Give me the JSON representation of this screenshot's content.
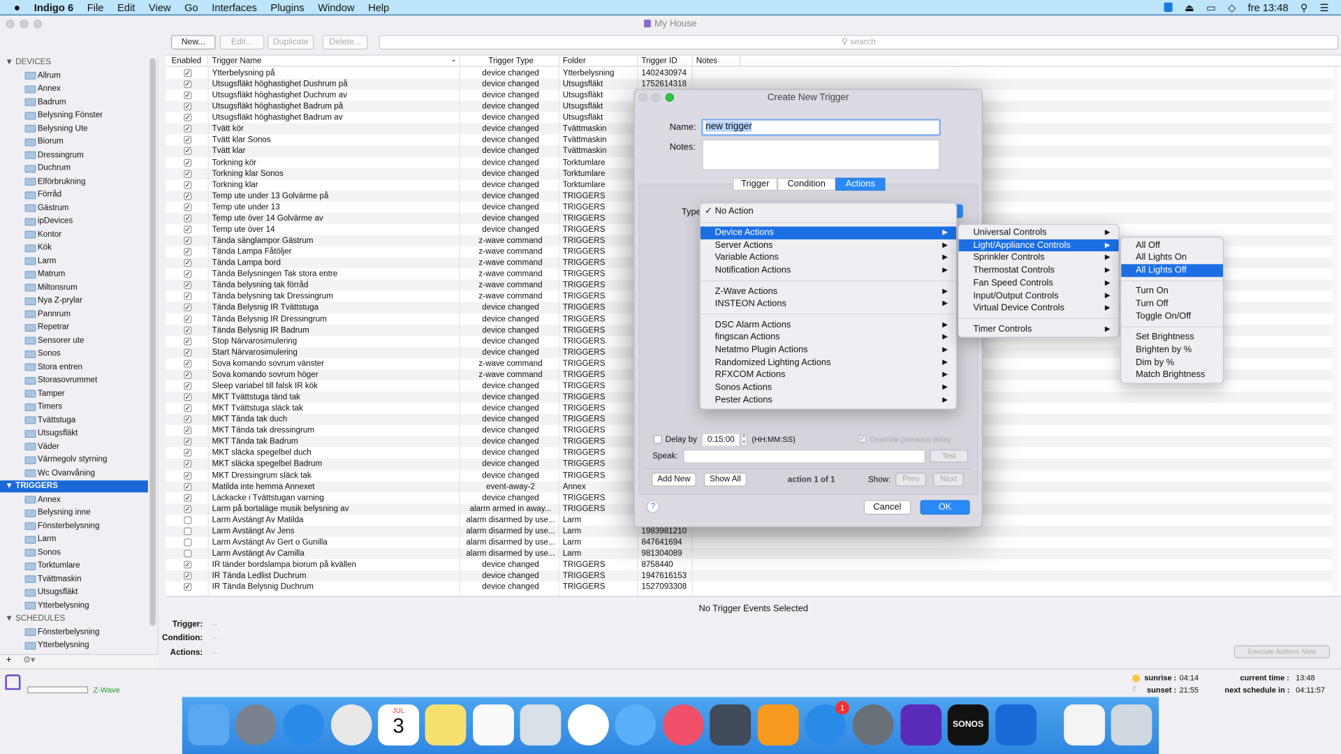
{
  "menubar": {
    "app": "Indigo 6",
    "items": [
      "File",
      "Edit",
      "View",
      "Go",
      "Interfaces",
      "Plugins",
      "Window",
      "Help"
    ],
    "clock": "fre 13:48",
    "icons": [
      "teamviewer-icon",
      "eject-icon",
      "airplay-icon",
      "wifi-icon",
      "spotlight-icon",
      "notification-center-icon"
    ]
  },
  "window": {
    "title": "My House"
  },
  "toolbar": {
    "new": "New...",
    "edit": "Edit...",
    "duplicate": "Duplicate",
    "delete": "Delete...",
    "search_placeholder": "search"
  },
  "sidebar": {
    "devices_label": "DEVICES",
    "devices": [
      "Allrum",
      "Annex",
      "Badrum",
      "Belysning Fönster",
      "Belysning Ute",
      "Biorum",
      "Dressingrum",
      "Duchrum",
      "Elförbrukning",
      "Förråd",
      "Gästrum",
      "ipDevices",
      "Kontor",
      "Kök",
      "Larm",
      "Matrum",
      "Miltonsrum",
      "Nya Z-prylar",
      "Pannrum",
      "Repetrar",
      "Sensorer ute",
      "Sonos",
      "Stora entren",
      "Storasovrummet",
      "Tamper",
      "Timers",
      "Tvättstuga",
      "Utsugsfläkt",
      "Väder",
      "Värmegolv styrning",
      "Wc Ovanvåning"
    ],
    "triggers_label": "TRIGGERS",
    "triggers": [
      "Annex",
      "Belysning inne",
      "Fönsterbelysning",
      "Larm",
      "Sonos",
      "Torktumlare",
      "Tvättmaskin",
      "Utsugsfläkt",
      "Ytterbelysning"
    ],
    "schedules_label": "SCHEDULES",
    "schedules": [
      "Fönsterbelysning",
      "Ytterbelysning"
    ],
    "add": "+",
    "gear": "⚙▾"
  },
  "table": {
    "columns": [
      "Enabled",
      "Trigger Name",
      "Trigger Type",
      "Folder",
      "Trigger ID",
      "Notes"
    ],
    "rows": [
      {
        "on": true,
        "name": "Ytterbelysning på",
        "type": "device changed",
        "folder": "Ytterbelysning",
        "id": "1402430974"
      },
      {
        "on": true,
        "name": "Utsugsfläkt höghastighet Dushrum på",
        "type": "device changed",
        "folder": "Utsugsfläkt",
        "id": "1752614318"
      },
      {
        "on": true,
        "name": "Utsugsfläkt höghastighet Duchrum av",
        "type": "device changed",
        "folder": "Utsugsfläkt",
        "id": ""
      },
      {
        "on": true,
        "name": "Utsugsfläkt höghastighet Badrum på",
        "type": "device changed",
        "folder": "Utsugsfläkt",
        "id": ""
      },
      {
        "on": true,
        "name": "Utsugsfläkt höghastighet Badrum av",
        "type": "device changed",
        "folder": "Utsugsfläkt",
        "id": ""
      },
      {
        "on": true,
        "name": "Tvätt kör",
        "type": "device changed",
        "folder": "Tvättmaskin",
        "id": ""
      },
      {
        "on": true,
        "name": "Tvätt klar Sonos",
        "type": "device changed",
        "folder": "Tvättmaskin",
        "id": ""
      },
      {
        "on": true,
        "name": "Tvätt klar",
        "type": "device changed",
        "folder": "Tvättmaskin",
        "id": ""
      },
      {
        "on": true,
        "name": "Torkning kör",
        "type": "device changed",
        "folder": "Torktumlare",
        "id": ""
      },
      {
        "on": true,
        "name": "Torkning klar Sonos",
        "type": "device changed",
        "folder": "Torktumlare",
        "id": ""
      },
      {
        "on": true,
        "name": "Torkning klar",
        "type": "device changed",
        "folder": "Torktumlare",
        "id": ""
      },
      {
        "on": true,
        "name": "Temp ute under 13 Golvärme på",
        "type": "device changed",
        "folder": "TRIGGERS",
        "id": ""
      },
      {
        "on": true,
        "name": "Temp ute under 13",
        "type": "device changed",
        "folder": "TRIGGERS",
        "id": ""
      },
      {
        "on": true,
        "name": "Temp ute över 14 Golvärme av",
        "type": "device changed",
        "folder": "TRIGGERS",
        "id": ""
      },
      {
        "on": true,
        "name": "Temp ute över 14",
        "type": "device changed",
        "folder": "TRIGGERS",
        "id": ""
      },
      {
        "on": true,
        "name": "Tända sänglampor Gästrum",
        "type": "z-wave command",
        "folder": "TRIGGERS",
        "id": ""
      },
      {
        "on": true,
        "name": "Tända Lampa Fåtöljer",
        "type": "z-wave command",
        "folder": "TRIGGERS",
        "id": ""
      },
      {
        "on": true,
        "name": "Tända Lampa bord",
        "type": "z-wave command",
        "folder": "TRIGGERS",
        "id": ""
      },
      {
        "on": true,
        "name": "Tända Belysningen Tak stora entre",
        "type": "z-wave command",
        "folder": "TRIGGERS",
        "id": ""
      },
      {
        "on": true,
        "name": "Tända belysning tak förråd",
        "type": "z-wave command",
        "folder": "TRIGGERS",
        "id": ""
      },
      {
        "on": true,
        "name": "Tända belysning tak Dressingrum",
        "type": "z-wave command",
        "folder": "TRIGGERS",
        "id": ""
      },
      {
        "on": true,
        "name": "Tända Belysnig IR Tvättstuga",
        "type": "device changed",
        "folder": "TRIGGERS",
        "id": ""
      },
      {
        "on": true,
        "name": "Tända Belysnig IR Dressingrum",
        "type": "device changed",
        "folder": "TRIGGERS",
        "id": ""
      },
      {
        "on": true,
        "name": "Tända Belysnig IR Badrum",
        "type": "device changed",
        "folder": "TRIGGERS",
        "id": ""
      },
      {
        "on": true,
        "name": "Stop Närvarosimulering",
        "type": "device changed",
        "folder": "TRIGGERS",
        "id": ""
      },
      {
        "on": true,
        "name": "Start Närvarosimulering",
        "type": "device changed",
        "folder": "TRIGGERS",
        "id": ""
      },
      {
        "on": true,
        "name": "Sova komando sovrum vänster",
        "type": "z-wave command",
        "folder": "TRIGGERS",
        "id": ""
      },
      {
        "on": true,
        "name": "Sova komando sovrum höger",
        "type": "z-wave command",
        "folder": "TRIGGERS",
        "id": ""
      },
      {
        "on": true,
        "name": "Sleep variabel till falsk IR kök",
        "type": "device changed",
        "folder": "TRIGGERS",
        "id": ""
      },
      {
        "on": true,
        "name": "MKT Tvättstuga tänd tak",
        "type": "device changed",
        "folder": "TRIGGERS",
        "id": ""
      },
      {
        "on": true,
        "name": "MKT Tvättstuga släck tak",
        "type": "device changed",
        "folder": "TRIGGERS",
        "id": ""
      },
      {
        "on": true,
        "name": "MKT Tända tak duch",
        "type": "device changed",
        "folder": "TRIGGERS",
        "id": ""
      },
      {
        "on": true,
        "name": "MKT Tända tak dressingrum",
        "type": "device changed",
        "folder": "TRIGGERS",
        "id": ""
      },
      {
        "on": true,
        "name": "MKT Tända tak Badrum",
        "type": "device changed",
        "folder": "TRIGGERS",
        "id": ""
      },
      {
        "on": true,
        "name": "MKT släcka spegelbel duch",
        "type": "device changed",
        "folder": "TRIGGERS",
        "id": ""
      },
      {
        "on": true,
        "name": "MKT släcka spegelbel Badrum",
        "type": "device changed",
        "folder": "TRIGGERS",
        "id": ""
      },
      {
        "on": true,
        "name": "MKT Dressingrum släck tak",
        "type": "device changed",
        "folder": "TRIGGERS",
        "id": ""
      },
      {
        "on": true,
        "name": "Matilda inte hemma Annexet",
        "type": "event-away-2",
        "folder": "Annex",
        "id": ""
      },
      {
        "on": true,
        "name": "Läckacke i Tvättstugan varning",
        "type": "device changed",
        "folder": "TRIGGERS",
        "id": ""
      },
      {
        "on": true,
        "name": "Larm på bortaläge musik belysning av",
        "type": "alarm armed in away...",
        "folder": "TRIGGERS",
        "id": ""
      },
      {
        "on": false,
        "name": "Larm Avstängt Av Matilda",
        "type": "alarm disarmed by use...",
        "folder": "Larm",
        "id": ""
      },
      {
        "on": false,
        "name": "Larm Avstängt Av Jens",
        "type": "alarm disarmed by use...",
        "folder": "Larm",
        "id": "1983981210"
      },
      {
        "on": false,
        "name": "Larm Avstängt Av Gert o Gunilla",
        "type": "alarm disarmed by use...",
        "folder": "Larm",
        "id": "847641694"
      },
      {
        "on": false,
        "name": "Larm Avstängt Av Camilla",
        "type": "alarm disarmed by use...",
        "folder": "Larm",
        "id": "981304089"
      },
      {
        "on": true,
        "name": "IR tänder bordslampa biorum på kvällen",
        "type": "device changed",
        "folder": "TRIGGERS",
        "id": "8758440"
      },
      {
        "on": true,
        "name": "IR Tända Ledlist Duchrum",
        "type": "device changed",
        "folder": "TRIGGERS",
        "id": "1947616153"
      },
      {
        "on": true,
        "name": "IR Tända Belysnig Duchrum",
        "type": "device changed",
        "folder": "TRIGGERS",
        "id": "1527093308"
      }
    ]
  },
  "detail": {
    "empty": "No Trigger Events Selected",
    "trigger_label": "Trigger:",
    "condition_label": "Condition:",
    "actions_label": "Actions:",
    "trigger": "--",
    "condition": "--",
    "actions": "--",
    "execute": "Execute Actions Now"
  },
  "status": {
    "interface": "Z-Wave",
    "sunrise_label": "sunrise :",
    "sunrise": "04:14",
    "sunset_label": "sunset :",
    "sunset": "21:55",
    "current_label": "current time :",
    "current": "13:48",
    "next_label": "next schedule in :",
    "next": "04:11:57"
  },
  "dialog": {
    "title": "Create New Trigger",
    "name_label": "Name:",
    "name_value": "new trigger",
    "notes_label": "Notes:",
    "notes_value": "",
    "tabs": [
      "Trigger",
      "Condition",
      "Actions"
    ],
    "active_tab": "Actions",
    "type_label": "Type",
    "delay_label": "Delay by",
    "delay_value": "0:15:00",
    "delay_unit": "(HH:MM:SS)",
    "override": "Override previous delay",
    "speak_label": "Speak:",
    "test": "Test",
    "add_new": "Add New",
    "show_all": "Show All",
    "counter": "action 1 of 1",
    "show_label": "Show:",
    "prev": "Prev",
    "next": "Next",
    "help": "?",
    "cancel": "Cancel",
    "ok": "OK"
  },
  "menus": {
    "main": {
      "checked": "No Action",
      "groups": [
        [
          "Device Actions",
          "Server Actions",
          "Variable Actions",
          "Notification Actions"
        ],
        [
          "Z-Wave Actions",
          "INSTEON Actions"
        ],
        [
          "DSC Alarm Actions",
          "fingscan Actions",
          "Netatmo Plugin Actions",
          "Randomized Lighting Actions",
          "RFXCOM Actions",
          "Sonos Actions",
          "Pester Actions"
        ]
      ],
      "highlighted": "Device Actions"
    },
    "device": {
      "groups": [
        [
          "Universal Controls",
          "Light/Appliance Controls",
          "Sprinkler Controls",
          "Thermostat Controls",
          "Fan Speed Controls",
          "Input/Output Controls",
          "Virtual Device Controls"
        ],
        [
          "Timer Controls"
        ]
      ],
      "highlighted": "Light/Appliance Controls"
    },
    "light": {
      "groups": [
        [
          "All Off",
          "All Lights On",
          "All Lights Off"
        ],
        [
          "Turn On",
          "Turn Off",
          "Toggle On/Off"
        ],
        [
          "Set Brightness",
          "Brighten by %",
          "Dim by %",
          "Match Brightness"
        ]
      ],
      "highlighted": "All Lights Off"
    }
  },
  "dock": {
    "apps": [
      "finder",
      "launchpad",
      "safari",
      "chrome",
      "calendar",
      "notes",
      "reminders",
      "preview",
      "photos",
      "messages",
      "itunes",
      "imovie",
      "ibooks",
      "app-store",
      "system-preferences",
      "indigo",
      "sonos",
      "teamviewer",
      "documents",
      "trash"
    ],
    "calendar_month": "JUL",
    "calendar_day": "3",
    "app_store_badge": "1",
    "sonos_label": "SONOS"
  },
  "colors": {
    "accent": "#1b6fe3",
    "menubar": "#bde6fd",
    "dock": "#3a90e6",
    "zwave": "#2a9a2a"
  }
}
